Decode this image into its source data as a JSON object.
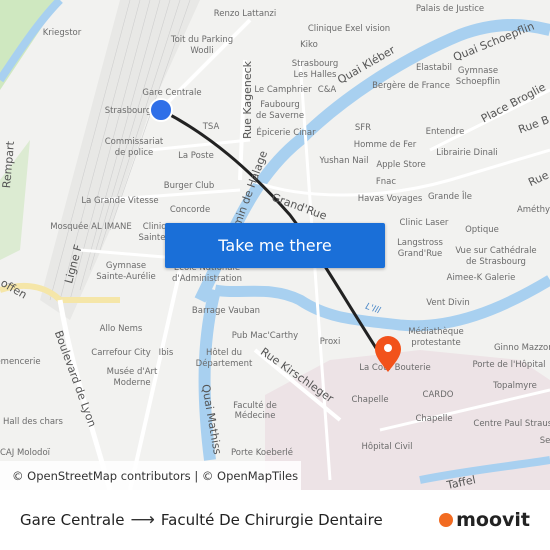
{
  "map": {
    "labels": [
      "Renzo Lattanzi",
      "Kriegstor",
      "Toit du Parking",
      "Wodli",
      "Gare Centrale",
      "Strasbourg",
      "TSA",
      "Commissariat",
      "de police",
      "La Poste",
      "Burger Club",
      "La Grande Vitesse",
      "Concorde",
      "Mosquée AL IMANE",
      "Clinique",
      "Sainte",
      "Gymnase",
      "Sainte-Aurélie",
      "École Nationale",
      "d'Administration",
      "Barrage Vauban",
      "Allo Nems",
      "Carrefour City",
      "Ibis",
      "Musée d'Art",
      "Moderne",
      "emencerie",
      "Hall des chars",
      "CAJ Molodoï",
      "Pub Mac'Carthy",
      "Hôtel du",
      "Département",
      "Faculté de",
      "Médecine",
      "Porte Koeberlé",
      "Palais de Justice",
      "Clinique Exel vision",
      "Kiko",
      "Strasbourg",
      "Les Halles",
      "Le Camphrier",
      "C&A",
      "Faubourg",
      "de Saverne",
      "Épicerie Cinar",
      "Elastabil",
      "Gymnase",
      "Schoepflin",
      "Bergère de France",
      "SFR",
      "Entendre",
      "Homme de Fer",
      "Librairie Dinali",
      "Yushan Nail",
      "Apple Store",
      "Fnac",
      "Havas Voyages",
      "Grande Île",
      "Clinic Laser",
      "Optique",
      "Améthyste",
      "Langstross",
      "Grand'Rue",
      "Vue sur Cathédrale",
      "de Strasbourg",
      "Aimee-K Galerie",
      "Vent Divin",
      "Médiathèque",
      "protestante",
      "Ginno Mazzoni",
      "Porte de l'Hôpital",
      "Proxi",
      "La Cour Bouterie",
      "Topalmyre",
      "CARDO",
      "Chapelle",
      "Chapelle",
      "Centre Paul Strauss",
      "Hôpital Civil",
      "Se"
    ],
    "streets": [
      "Quai Kléber",
      "Quai Schoepflin",
      "Place Broglie",
      "Rue B",
      "Rue",
      "Rue Kageneck",
      "Chemin de Halage",
      "Grand'Rue",
      "Rue Kirschleger",
      "Quai Mathiss",
      "Boulevard de Lyon",
      "Ligne F",
      "Rempart",
      "offen",
      "Taffel"
    ],
    "water": "L'Ill",
    "origin_marker_color": "#2f6fe8",
    "destination_marker_color": "#f2521b",
    "route_color": "#222222"
  },
  "cta_label": "Take me there",
  "attribution": {
    "osm": "© OpenStreetMap contributors",
    "sep": " | ",
    "omt": "© OpenMapTiles"
  },
  "footer": {
    "from": "Gare Centrale",
    "arrow_icon": "arrow-right-icon",
    "to": "Faculté De Chirurgie Dentaire",
    "logo": "moovit",
    "logo_color": "#f26b21"
  }
}
